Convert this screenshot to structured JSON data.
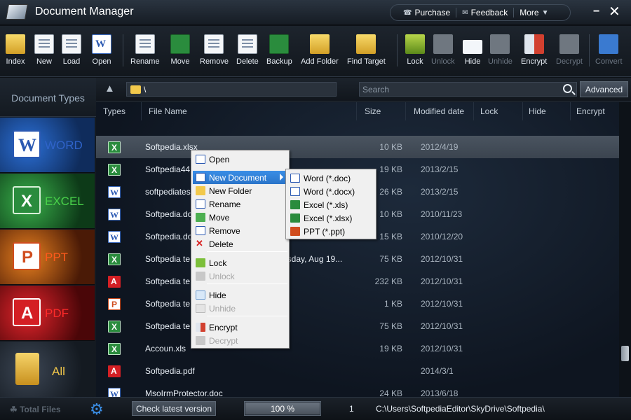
{
  "app": {
    "title": "Document Manager",
    "links": {
      "purchase": "Purchase",
      "feedback": "Feedback",
      "more": "More"
    }
  },
  "toolbar": {
    "items": [
      {
        "label": "Index",
        "icon": "folder-search-icon",
        "enabled": true
      },
      {
        "label": "New",
        "icon": "new-document-icon",
        "enabled": true
      },
      {
        "label": "Load",
        "icon": "load-document-icon",
        "enabled": true
      },
      {
        "label": "Open",
        "icon": "open-document-icon",
        "enabled": true
      },
      {
        "label": "Rename",
        "icon": "rename-icon",
        "enabled": true
      },
      {
        "label": "Move",
        "icon": "move-icon",
        "enabled": true
      },
      {
        "label": "Remove",
        "icon": "remove-icon",
        "enabled": true
      },
      {
        "label": "Delete",
        "icon": "delete-icon",
        "enabled": true
      },
      {
        "label": "Backup",
        "icon": "backup-icon",
        "enabled": true
      },
      {
        "label": "Add Folder",
        "icon": "add-folder-icon",
        "enabled": true
      },
      {
        "label": "Find Target",
        "icon": "find-target-icon",
        "enabled": true
      },
      {
        "label": "Lock",
        "icon": "lock-icon",
        "enabled": true
      },
      {
        "label": "Unlock",
        "icon": "unlock-icon",
        "enabled": false
      },
      {
        "label": "Hide",
        "icon": "hide-cloud-icon",
        "enabled": true
      },
      {
        "label": "Unhide",
        "icon": "unhide-cloud-icon",
        "enabled": false
      },
      {
        "label": "Encrypt",
        "icon": "encrypt-shield-icon",
        "enabled": true
      },
      {
        "label": "Decrypt",
        "icon": "decrypt-icon",
        "enabled": false
      },
      {
        "label": "Convert",
        "icon": "convert-icon",
        "enabled": false
      }
    ]
  },
  "sidebar": {
    "title": "Document Types",
    "types": [
      {
        "label": "WORD",
        "icon": "word-icon"
      },
      {
        "label": "EXCEL",
        "icon": "excel-icon"
      },
      {
        "label": "PPT",
        "icon": "powerpoint-icon"
      },
      {
        "label": "PDF",
        "icon": "pdf-icon"
      },
      {
        "label": "All",
        "icon": "all-folder-icon"
      }
    ]
  },
  "pathbar": {
    "path": "\\",
    "search_placeholder": "Search",
    "advanced": "Advanced"
  },
  "columns": [
    "Types",
    "File Name",
    "Size",
    "Modified date",
    "Lock",
    "Hide",
    "Encrypt"
  ],
  "files": [
    {
      "type": "xlsx",
      "name": "Softpedia.xlsx",
      "size": "10 KB",
      "date": "2012/4/19",
      "selected": true
    },
    {
      "type": "xlsx",
      "name": "Softpedia44",
      "size": "19 KB",
      "date": "2013/2/15"
    },
    {
      "type": "docx",
      "name": "softpediates",
      "size": "26 KB",
      "date": "2013/2/15"
    },
    {
      "type": "docx",
      "name": "Softpedia.do",
      "size": "10 KB",
      "date": "2010/11/23"
    },
    {
      "type": "docx",
      "name": "Softpedia.do",
      "size": "15 KB",
      "date": "2010/12/20"
    },
    {
      "type": "xlsx",
      "name": "Softpedia te",
      "extra": "esday, Aug 19...",
      "size": "75 KB",
      "date": "2012/10/31"
    },
    {
      "type": "pdf",
      "name": "Softpedia te",
      "size": "232 KB",
      "date": "2012/10/31"
    },
    {
      "type": "ppt",
      "name": "Softpedia te",
      "size": "1 KB",
      "date": "2012/10/31"
    },
    {
      "type": "xlsx",
      "name": "Softpedia te",
      "size": "75 KB",
      "date": "2012/10/31"
    },
    {
      "type": "xlsx",
      "name": "Accoun.xls",
      "size": "19 KB",
      "date": "2012/10/31"
    },
    {
      "type": "pdf",
      "name": "Softpedia.pdf",
      "size": "",
      "date": "2014/3/1"
    },
    {
      "type": "docx",
      "name": "MsoIrmProtector.doc",
      "size": "24 KB",
      "date": "2013/6/18"
    }
  ],
  "context_menu": {
    "items": [
      {
        "label": "Open",
        "icon": "word-open-icon",
        "enabled": true
      },
      {
        "label": "New Document",
        "icon": "new-document-icon",
        "enabled": true,
        "highlighted": true,
        "submenu": true
      },
      {
        "label": "New Folder",
        "icon": "new-folder-icon",
        "enabled": true
      },
      {
        "label": "Rename",
        "icon": "rename-icon",
        "enabled": true
      },
      {
        "label": "Move",
        "icon": "move-icon",
        "enabled": true
      },
      {
        "label": "Remove",
        "icon": "remove-icon",
        "enabled": true
      },
      {
        "label": "Delete",
        "icon": "delete-x-icon",
        "enabled": true
      },
      {
        "label": "Lock",
        "icon": "lock-icon",
        "enabled": true
      },
      {
        "label": "Unlock",
        "icon": "unlock-icon",
        "enabled": false
      },
      {
        "label": "Hide",
        "icon": "hide-cloud-icon",
        "enabled": true
      },
      {
        "label": "Unhide",
        "icon": "unhide-cloud-icon",
        "enabled": false
      },
      {
        "label": "Encrypt",
        "icon": "encrypt-shield-icon",
        "enabled": true
      },
      {
        "label": "Decrypt",
        "icon": "decrypt-icon",
        "enabled": false
      }
    ]
  },
  "submenu": {
    "items": [
      {
        "label": "Word (*.doc)",
        "icon": "word-icon"
      },
      {
        "label": "Word (*.docx)",
        "icon": "word-icon"
      },
      {
        "label": "Excel (*.xls)",
        "icon": "excel-icon"
      },
      {
        "label": "Excel (*.xlsx)",
        "icon": "excel-icon"
      },
      {
        "label": "PPT (*.ppt)",
        "icon": "powerpoint-icon"
      }
    ]
  },
  "status": {
    "total_files_label": "Total Files",
    "check_version": "Check latest version",
    "progress": "100 %",
    "progress_fraction": 1.0,
    "page": "1",
    "path": "C:\\Users\\SoftpediaEditor\\SkyDrive\\Softpedia\\"
  }
}
